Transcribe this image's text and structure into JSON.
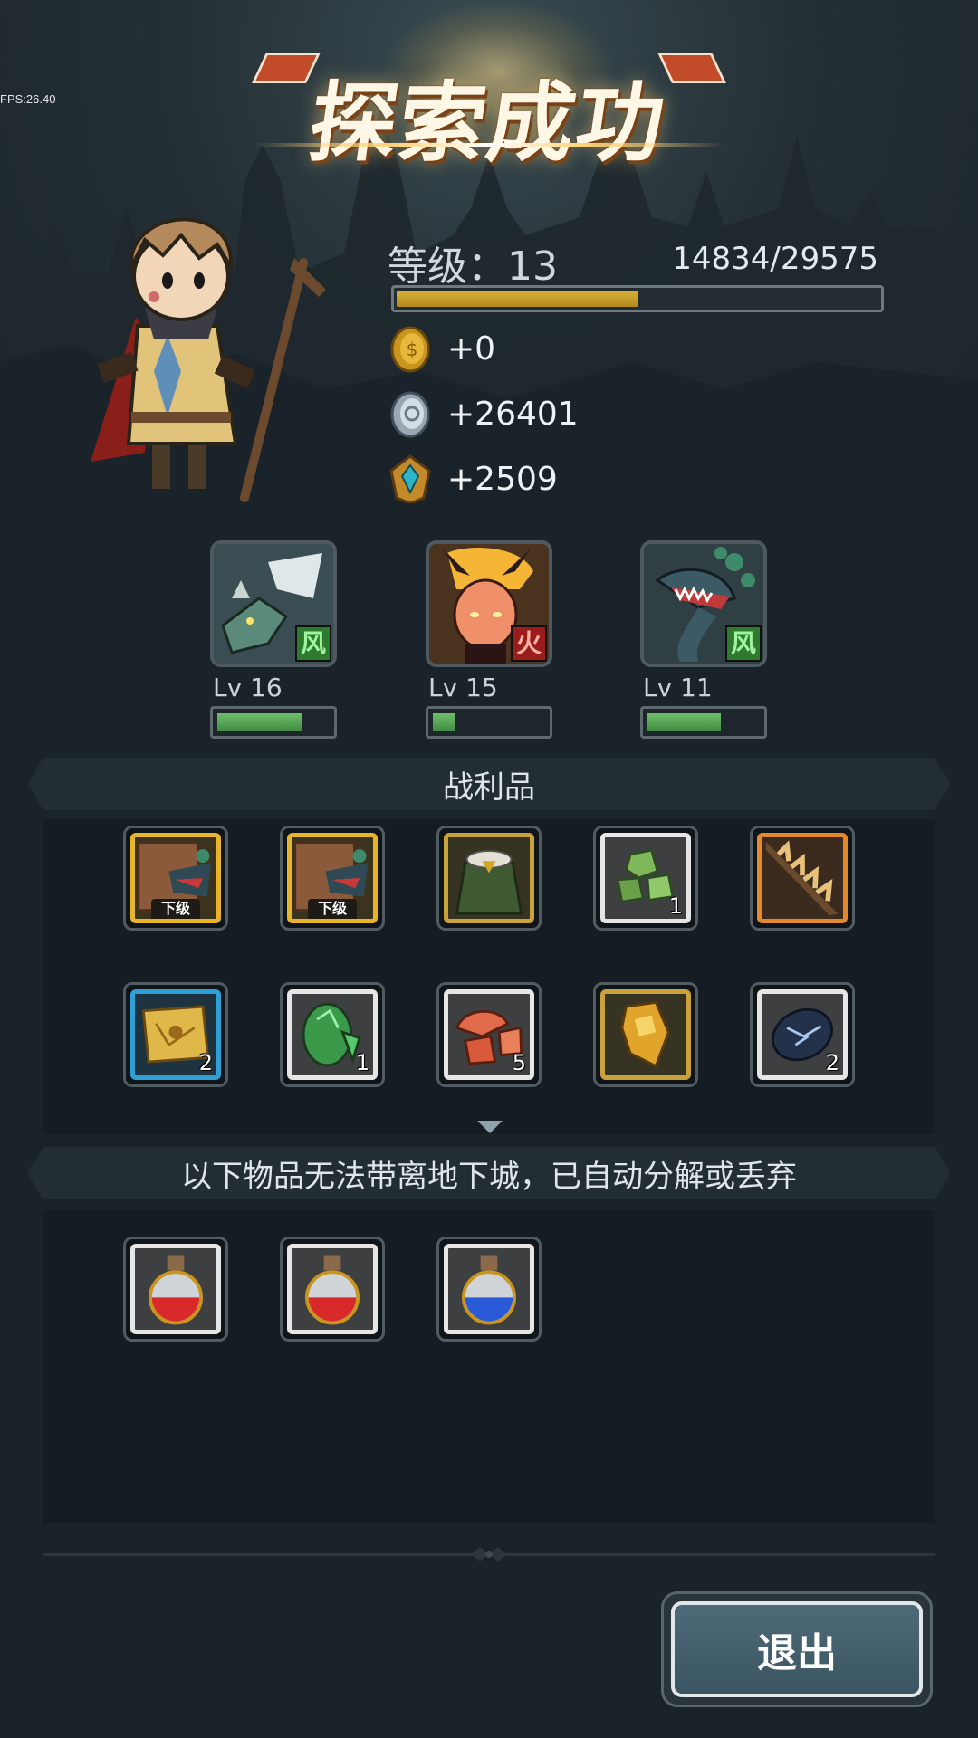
{
  "fps": "FPS:26.40",
  "title": "探索成功",
  "player": {
    "level_text": "等级：13",
    "exp_text": "14834/29575",
    "exp_progress": 0.5016
  },
  "rewards": [
    {
      "icon": "gold-coin-icon",
      "value": "+0"
    },
    {
      "icon": "silver-coin-icon",
      "value": "+26401"
    },
    {
      "icon": "crest-badge-icon",
      "value": "+2509"
    }
  ],
  "pets": [
    {
      "name": "wind-dragon",
      "element": "风",
      "level": "Lv 16",
      "progress": 0.75
    },
    {
      "name": "fire-spirit",
      "element": "火",
      "level": "Lv 15",
      "progress": 0.2
    },
    {
      "name": "plant-beast",
      "element": "风",
      "level": "Lv 11",
      "progress": 0.65
    }
  ],
  "loot_header": "战利品",
  "loot_items": [
    {
      "icon": "map-scroll-dragon-icon",
      "frame": "gold",
      "tag": "下级",
      "count": ""
    },
    {
      "icon": "map-scroll-dragon-icon",
      "frame": "gold",
      "tag": "下级",
      "count": ""
    },
    {
      "icon": "green-cloak-icon",
      "frame": "yellow",
      "tag": "",
      "count": ""
    },
    {
      "icon": "green-crystal-icon",
      "frame": "white",
      "tag": "",
      "count": "1"
    },
    {
      "icon": "spiked-tail-icon",
      "frame": "orange",
      "tag": "",
      "count": ""
    },
    {
      "icon": "treasure-map-icon",
      "frame": "blue",
      "tag": "",
      "count": "2"
    },
    {
      "icon": "emerald-shard-icon",
      "frame": "white",
      "tag": "",
      "count": "1"
    },
    {
      "icon": "red-ore-icon",
      "frame": "white",
      "tag": "",
      "count": "5"
    },
    {
      "icon": "gold-gauntlet-icon",
      "frame": "yellow",
      "tag": "",
      "count": ""
    },
    {
      "icon": "dark-shell-icon",
      "frame": "white",
      "tag": "",
      "count": "2"
    }
  ],
  "discard_header": "以下物品无法带离地下城，已自动分解或丢弃",
  "discard_items": [
    {
      "icon": "red-potion-icon",
      "color": "#d82a2a"
    },
    {
      "icon": "red-potion-icon",
      "color": "#d82a2a"
    },
    {
      "icon": "blue-potion-icon",
      "color": "#2a5ad8"
    }
  ],
  "exit_label": "退出"
}
